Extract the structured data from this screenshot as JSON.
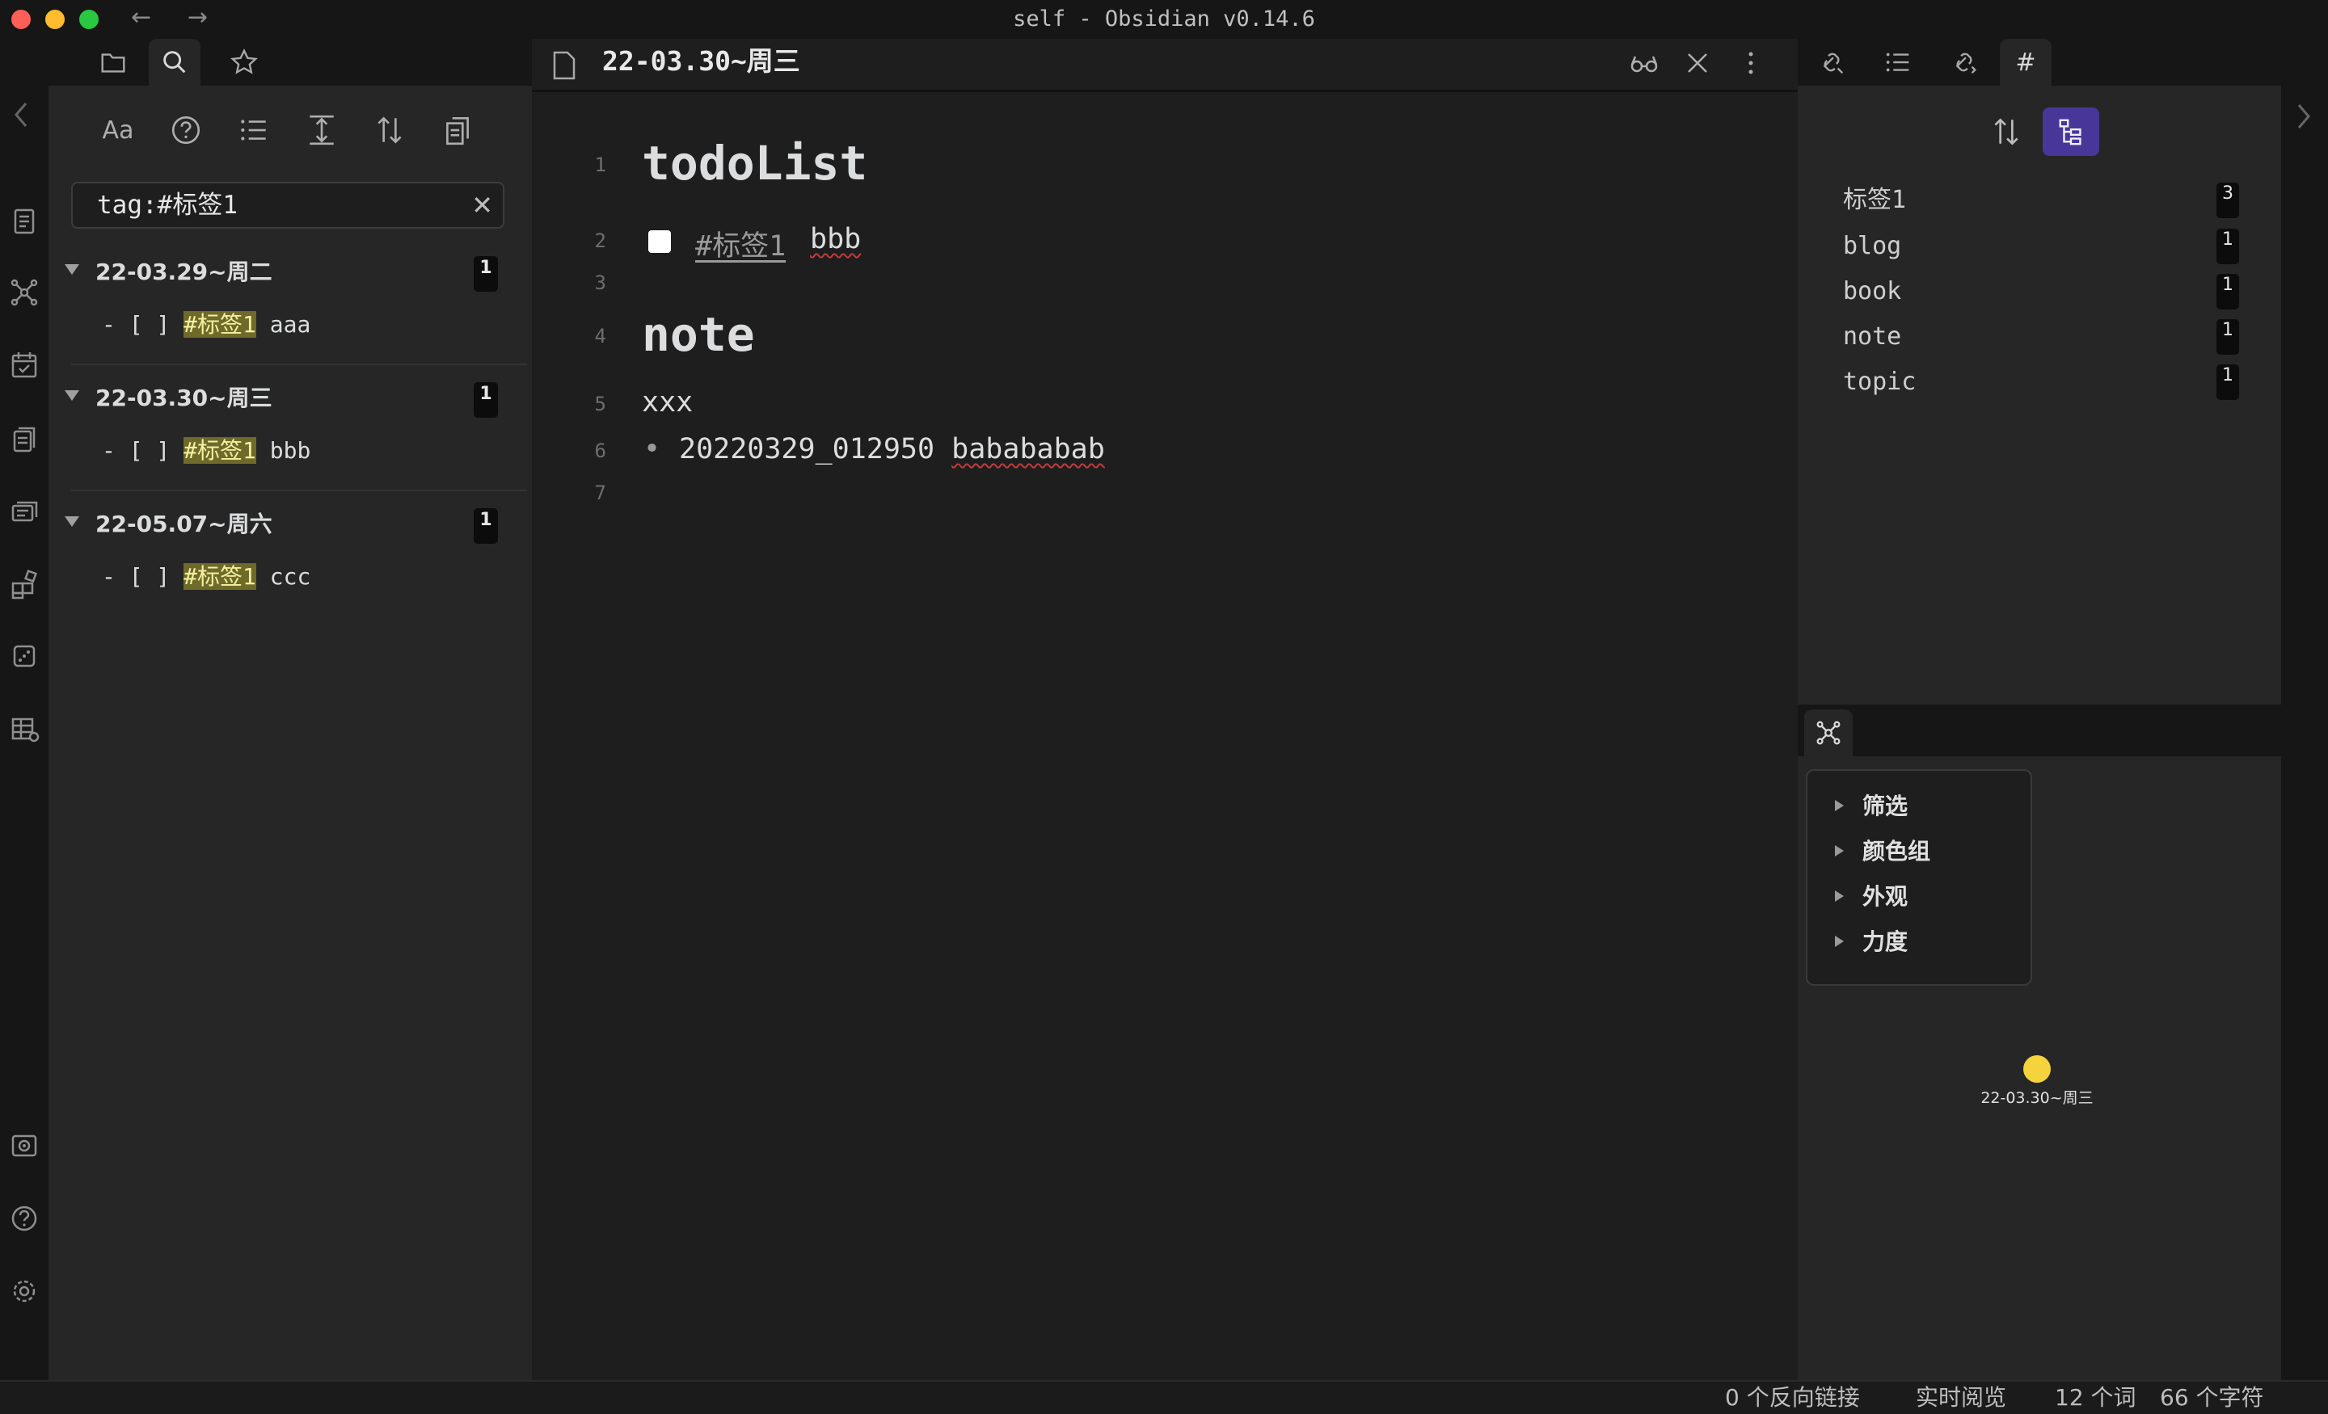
{
  "window": {
    "title": "self - Obsidian v0.14.6"
  },
  "ribbon": {
    "icons": [
      "file-switcher-icon",
      "graph-view-icon",
      "daily-note-icon",
      "template-icon",
      "slides-icon",
      "kanban-icon",
      "random-note-icon",
      "table-icon",
      "vault-icon",
      "help-icon",
      "settings-icon"
    ]
  },
  "left_sidebar": {
    "tabs": [
      "folder-icon",
      "search-icon",
      "star-icon"
    ],
    "tools": [
      "match-case-icon",
      "help-icon",
      "list-icon",
      "collapse-icon",
      "sort-icon",
      "copy-icon"
    ],
    "tools_text": {
      "match_case": "Aa"
    },
    "search": {
      "value": "tag:#标签1",
      "clear": "✕"
    },
    "results": [
      {
        "title": "22-03.29~周二",
        "count": "1",
        "prefix": "- [ ] ",
        "tag": "#标签1",
        "text": " aaa"
      },
      {
        "title": "22-03.30~周三",
        "count": "1",
        "prefix": "- [ ] ",
        "tag": "#标签1",
        "text": " bbb"
      },
      {
        "title": "22-05.07~周六",
        "count": "1",
        "prefix": "- [ ] ",
        "tag": "#标签1",
        "text": " ccc"
      }
    ]
  },
  "editor": {
    "title": "22-03.30~周三",
    "line_numbers": [
      "1",
      "2",
      "3",
      "4",
      "5",
      "6",
      "7"
    ],
    "heading1": "todoList",
    "task_tag": "#标签1",
    "task_text": "bbb",
    "heading2": "note",
    "line5": "xxx",
    "bullet": "•",
    "line6_a": "20220329_012950 ",
    "line6_b": "babababab"
  },
  "right_sidebar": {
    "tabs": [
      "backlinks-icon",
      "outline-icon",
      "outgoing-links-icon",
      "tag-icon"
    ],
    "tag_tab_glyph": "#",
    "tags": [
      {
        "name": "标签1",
        "count": "3"
      },
      {
        "name": "blog",
        "count": "1"
      },
      {
        "name": "book",
        "count": "1"
      },
      {
        "name": "note",
        "count": "1"
      },
      {
        "name": "topic",
        "count": "1"
      }
    ],
    "graph_settings": [
      "筛选",
      "颜色组",
      "外观",
      "力度"
    ],
    "graph_node": {
      "label": "22-03.30~周三",
      "color": "#f5d33c"
    }
  },
  "status": {
    "backlinks": "0 个反向链接",
    "mode": "实时阅览",
    "words": "12 个词",
    "chars": "66 个字符"
  },
  "colors": {
    "accent": "#483699",
    "tag_highlight": "#6e6a2a",
    "bg": "#1e1e1e"
  }
}
